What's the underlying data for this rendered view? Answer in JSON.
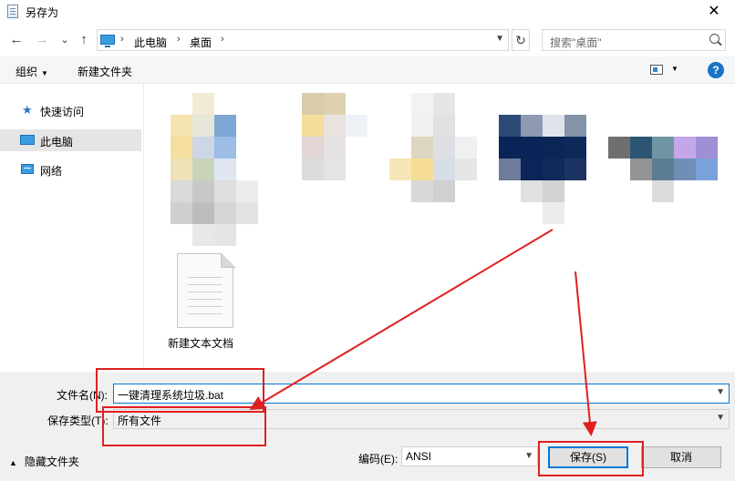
{
  "window": {
    "title": "另存为",
    "close_glyph": "✕"
  },
  "nav": {
    "back_glyph": "←",
    "forward_glyph": "→",
    "recent_glyph": "⌄",
    "up_glyph": "↑",
    "breadcrumb": [
      "此电脑",
      "桌面"
    ],
    "breadcrumb_sep": "›",
    "refresh_glyph": "↻",
    "search_placeholder": "搜索\"桌面\""
  },
  "toolbar": {
    "organize_label": "组织",
    "new_folder_label": "新建文件夹",
    "help_glyph": "?"
  },
  "sidebar": {
    "items": [
      {
        "label": "快速访问",
        "icon": "star-icon"
      },
      {
        "label": "此电脑",
        "icon": "computer-icon",
        "selected": true
      },
      {
        "label": "网络",
        "icon": "network-icon"
      }
    ]
  },
  "files": {
    "items": [
      {
        "name": "新建文本文档",
        "icon": "text-document-icon"
      }
    ]
  },
  "form": {
    "filename_label": "文件名(N):",
    "filename_value": "一键清理系统垃圾.bat",
    "filetype_label": "保存类型(T):",
    "filetype_value": "所有文件",
    "hide_folders_label": "隐藏文件夹",
    "encoding_label": "编码(E):",
    "encoding_value": "ANSI",
    "save_label": "保存(S)",
    "cancel_label": "取消"
  },
  "colors": {
    "accent": "#0078d7",
    "annotation": "#e02020",
    "help": "#1a73c6"
  }
}
